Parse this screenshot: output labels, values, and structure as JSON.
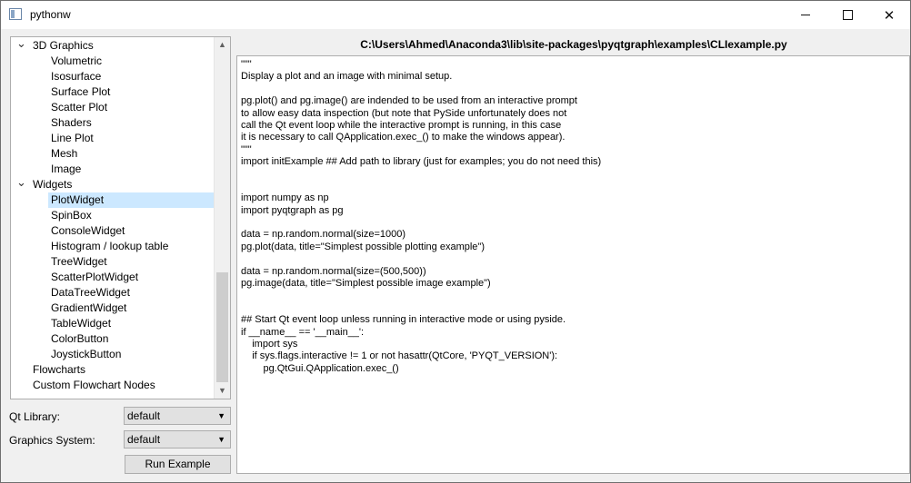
{
  "window": {
    "title": "pythonw"
  },
  "tree": {
    "items": [
      {
        "label": "3D Graphics",
        "level": 0,
        "expanded": true
      },
      {
        "label": "Volumetric",
        "level": 1
      },
      {
        "label": "Isosurface",
        "level": 1
      },
      {
        "label": "Surface Plot",
        "level": 1
      },
      {
        "label": "Scatter Plot",
        "level": 1
      },
      {
        "label": "Shaders",
        "level": 1
      },
      {
        "label": "Line Plot",
        "level": 1
      },
      {
        "label": "Mesh",
        "level": 1
      },
      {
        "label": "Image",
        "level": 1
      },
      {
        "label": "Widgets",
        "level": 0,
        "expanded": true
      },
      {
        "label": "PlotWidget",
        "level": 1,
        "selected": true
      },
      {
        "label": "SpinBox",
        "level": 1
      },
      {
        "label": "ConsoleWidget",
        "level": 1
      },
      {
        "label": "Histogram / lookup table",
        "level": 1
      },
      {
        "label": "TreeWidget",
        "level": 1
      },
      {
        "label": "ScatterPlotWidget",
        "level": 1
      },
      {
        "label": "DataTreeWidget",
        "level": 1
      },
      {
        "label": "GradientWidget",
        "level": 1
      },
      {
        "label": "TableWidget",
        "level": 1
      },
      {
        "label": "ColorButton",
        "level": 1
      },
      {
        "label": "JoystickButton",
        "level": 1
      },
      {
        "label": "Flowcharts",
        "level": 0
      },
      {
        "label": "Custom Flowchart Nodes",
        "level": 0
      }
    ]
  },
  "controls": {
    "qt_library_label": "Qt Library:",
    "qt_library_value": "default",
    "graphics_system_label": "Graphics System:",
    "graphics_system_value": "default",
    "run_label": "Run Example"
  },
  "editor": {
    "path": "C:\\Users\\Ahmed\\Anaconda3\\lib\\site-packages\\pyqtgraph\\examples\\CLIexample.py",
    "lines": [
      "\"\"\"",
      "Display a plot and an image with minimal setup.",
      "",
      "pg.plot() and pg.image() are indended to be used from an interactive prompt",
      "to allow easy data inspection (but note that PySide unfortunately does not",
      "call the Qt event loop while the interactive prompt is running, in this case",
      "it is necessary to call QApplication.exec_() to make the windows appear).",
      "\"\"\"",
      "import initExample ## Add path to library (just for examples; you do not need this)",
      "",
      "",
      "import numpy as np",
      "import pyqtgraph as pg",
      "",
      "data = np.random.normal(size=1000)",
      "pg.plot(data, title=\"Simplest possible plotting example\")",
      "",
      "data = np.random.normal(size=(500,500))",
      "pg.image(data, title=\"Simplest possible image example\")",
      "",
      "",
      "## Start Qt event loop unless running in interactive mode or using pyside.",
      "if __name__ == '__main__':",
      "    import sys",
      "    if sys.flags.interactive != 1 or not hasattr(QtCore, 'PYQT_VERSION'):",
      "        pg.QtGui.QApplication.exec_()"
    ]
  }
}
